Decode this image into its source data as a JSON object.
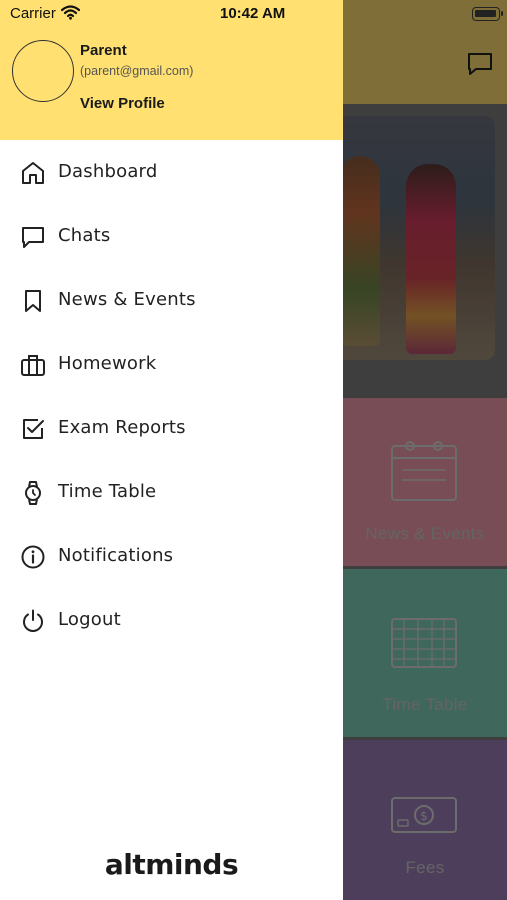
{
  "status_bar": {
    "carrier": "Carrier",
    "time": "10:42 AM",
    "battery_level": 1.0
  },
  "drawer": {
    "user": {
      "name": "Parent",
      "email": "(parent@gmail.com)",
      "view_profile_label": "View Profile"
    },
    "menu": [
      {
        "id": "dashboard",
        "label": "Dashboard",
        "icon": "home-icon"
      },
      {
        "id": "chats",
        "label": "Chats",
        "icon": "chat-icon"
      },
      {
        "id": "news-events",
        "label": "News & Events",
        "icon": "bookmark-icon"
      },
      {
        "id": "homework",
        "label": "Homework",
        "icon": "briefcase-icon"
      },
      {
        "id": "exam-reports",
        "label": "Exam Reports",
        "icon": "checkbox-icon"
      },
      {
        "id": "time-table",
        "label": "Time Table",
        "icon": "watch-icon"
      },
      {
        "id": "notifications",
        "label": "Notifications",
        "icon": "info-icon"
      },
      {
        "id": "logout",
        "label": "Logout",
        "icon": "power-icon"
      }
    ],
    "brand": "altminds"
  },
  "background": {
    "header_color": "#ffdc6e",
    "tiles": [
      {
        "label": "News & Events",
        "color": "#f09aaa",
        "icon": "calendar-icon"
      },
      {
        "label": "Time Table",
        "color": "#7fcfb6",
        "icon": "timetable-grid-icon"
      },
      {
        "label": "Fees",
        "color": "#9a7fb8",
        "icon": "money-icon"
      }
    ]
  },
  "colors": {
    "accent": "#ffe071",
    "text": "#222222"
  }
}
